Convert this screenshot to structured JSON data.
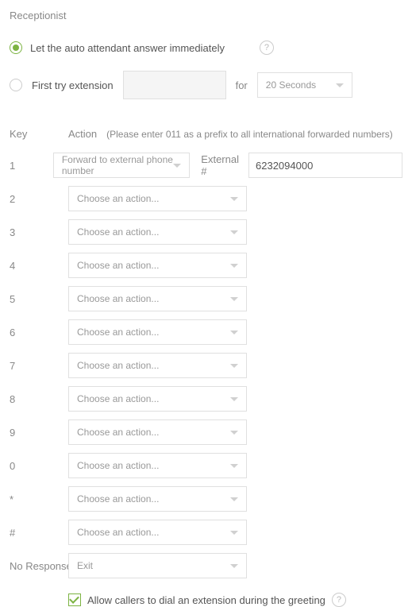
{
  "section_title": "Receptionist",
  "option_auto": "Let the auto attendant answer immediately",
  "option_try": "First try extension",
  "for_label": "for",
  "seconds_selected": "20 Seconds",
  "headers": {
    "key": "Key",
    "action": "Action"
  },
  "hint": "(Please enter 011 as a prefix to all international forwarded numbers)",
  "placeholder_action": "Choose an action...",
  "external_label": "External #",
  "external_value": "6232094000",
  "keys": {
    "k1": {
      "label": "1",
      "action": "Forward to external phone number"
    },
    "k2": {
      "label": "2",
      "action": "Choose an action..."
    },
    "k3": {
      "label": "3",
      "action": "Choose an action..."
    },
    "k4": {
      "label": "4",
      "action": "Choose an action..."
    },
    "k5": {
      "label": "5",
      "action": "Choose an action..."
    },
    "k6": {
      "label": "6",
      "action": "Choose an action..."
    },
    "k7": {
      "label": "7",
      "action": "Choose an action..."
    },
    "k8": {
      "label": "8",
      "action": "Choose an action..."
    },
    "k9": {
      "label": "9",
      "action": "Choose an action..."
    },
    "k0": {
      "label": "0",
      "action": "Choose an action..."
    },
    "kstar": {
      "label": "*",
      "action": "Choose an action..."
    },
    "khash": {
      "label": "#",
      "action": "Choose an action..."
    }
  },
  "no_response": {
    "label": "No Response",
    "action": "Exit"
  },
  "allow_label": "Allow callers to dial an extension during the greeting"
}
